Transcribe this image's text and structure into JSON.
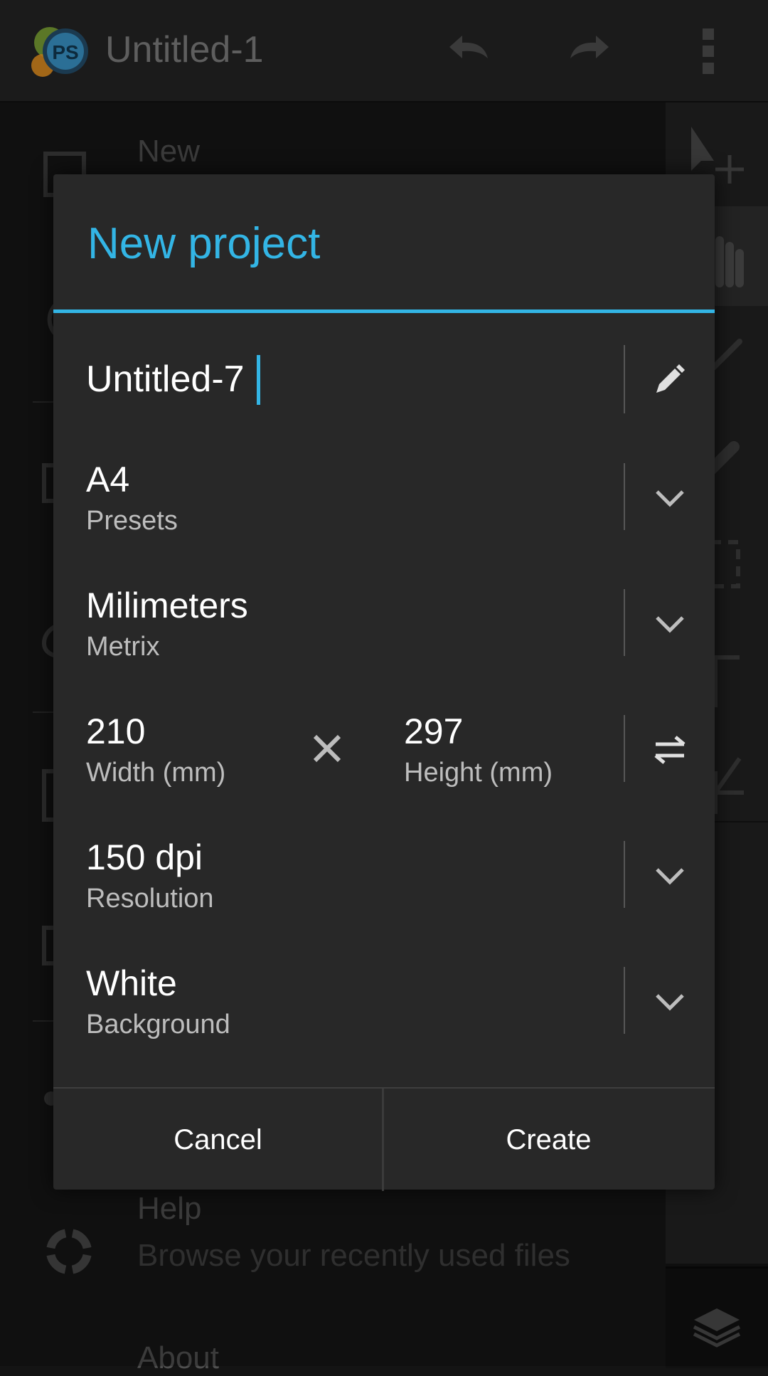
{
  "app": {
    "title": "Untitled-1",
    "logo_text": "PS"
  },
  "menu": {
    "new_label": "New",
    "help_label": "Help",
    "help_sub": "Browse your recently used files",
    "about_label": "About"
  },
  "dialog": {
    "title": "New project",
    "name_value": "Untitled-7",
    "preset": {
      "value": "A4",
      "label": "Presets"
    },
    "metric": {
      "value": "Milimeters",
      "label": "Metrix"
    },
    "width": {
      "value": "210",
      "label": "Width (mm)"
    },
    "height": {
      "value": "297",
      "label": "Height (mm)"
    },
    "resolution": {
      "value": "150 dpi",
      "label": "Resolution"
    },
    "background": {
      "value": "White",
      "label": "Background"
    },
    "cancel_label": "Cancel",
    "create_label": "Create"
  },
  "colors": {
    "accent": "#33b5e5",
    "dialog_bg": "#282828",
    "app_bg": "#161616"
  },
  "icons": {
    "name_edit": "pencil-icon",
    "dropdown": "chevron-down-icon",
    "multiply": "multiply-icon",
    "swap": "swap-icon"
  }
}
